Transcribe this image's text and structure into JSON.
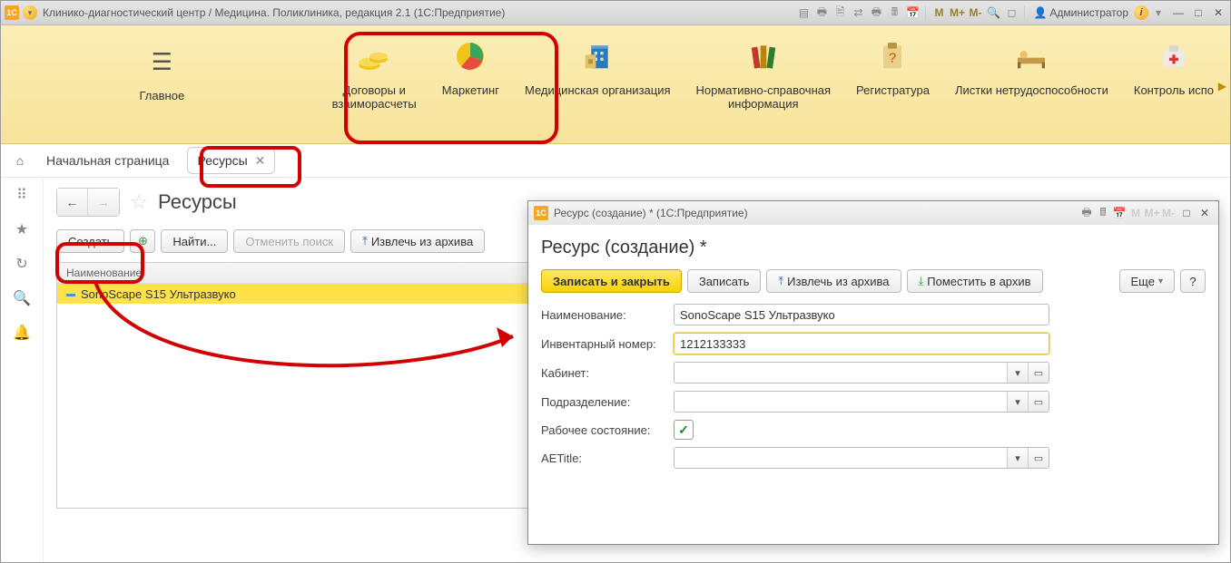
{
  "app": {
    "title": "Клинико-диагностический центр / Медицина. Поликлиника, редакция 2.1  (1С:Предприятие)",
    "user_label": "Администратор",
    "m_label": "M",
    "mplus_label": "M+",
    "mminus_label": "M-"
  },
  "sections": [
    {
      "label": "Главное"
    },
    {
      "label": "Договоры и\nвзаиморасчеты"
    },
    {
      "label": "Маркетинг"
    },
    {
      "label": "Медицинская организация"
    },
    {
      "label": "Нормативно-справочная\nинформация"
    },
    {
      "label": "Регистратура"
    },
    {
      "label": "Листки нетрудоспособности"
    },
    {
      "label": "Контроль испо"
    }
  ],
  "tabs": {
    "home": "Начальная страница",
    "active": "Ресурсы"
  },
  "page": {
    "title": "Ресурсы",
    "toolbar": {
      "create": "Создать",
      "find": "Найти...",
      "cancel_search": "Отменить поиск",
      "extract": "Извлечь из архива"
    },
    "list": {
      "header": "Наименование",
      "rows": [
        {
          "name": "SonoScape S15 Ультразвуко"
        }
      ]
    }
  },
  "dialog": {
    "title": "Ресурс (создание) *  (1С:Предприятие)",
    "heading": "Ресурс (создание) *",
    "m_label": "M",
    "mplus_label": "M+",
    "mminus_label": "M-",
    "toolbar": {
      "save_close": "Записать и закрыть",
      "save": "Записать",
      "extract": "Извлечь из архива",
      "archive": "Поместить в архив",
      "more": "Еще",
      "help": "?"
    },
    "form": {
      "name_label": "Наименование:",
      "name_value": "SonoScape S15 Ультразвуко",
      "inv_label": "Инвентарный номер:",
      "inv_value": "1212133333",
      "cabinet_label": "Кабинет:",
      "cabinet_value": "",
      "dept_label": "Подразделение:",
      "dept_value": "",
      "working_label": "Рабочее состояние:",
      "working_checked": true,
      "aetitle_label": "AETitle:",
      "aetitle_value": ""
    }
  }
}
